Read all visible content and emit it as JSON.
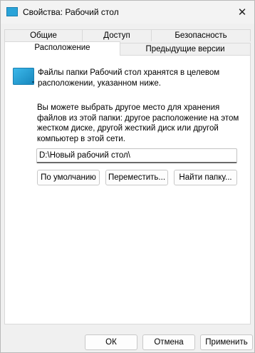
{
  "window": {
    "title": "Свойства: Рабочий стол"
  },
  "tabs": [
    {
      "label": "Общие"
    },
    {
      "label": "Доступ"
    },
    {
      "label": "Безопасность"
    },
    {
      "label": "Расположение"
    },
    {
      "label": "Предыдущие версии"
    }
  ],
  "content": {
    "intro_line1": "Файлы папки Рабочий стол хранятся в целевом",
    "intro_line2": "расположении, указанном ниже.",
    "desc_line1": "Вы можете выбрать другое место для хранения",
    "desc_line2": "файлов из этой папки: другое расположение на этом",
    "desc_line3": "жестком диске, другой жесткий диск или другой",
    "desc_line4": "компьютер в этой сети.",
    "path_value": "D:\\Новый рабочий стол\\"
  },
  "buttons": {
    "default_label": "По умолчанию",
    "move_label": "Переместить...",
    "find_label": "Найти папку...",
    "ok_label": "ОК",
    "cancel_label": "Отмена",
    "apply_label": "Применить"
  },
  "icons": {
    "title_icon": "desktop-folder-icon",
    "folder_icon": "desktop-folder-icon",
    "close_icon": "close-icon"
  },
  "colors": {
    "folder_blue": "#2aa3d8",
    "folder_dark": "#1a7fb0"
  }
}
